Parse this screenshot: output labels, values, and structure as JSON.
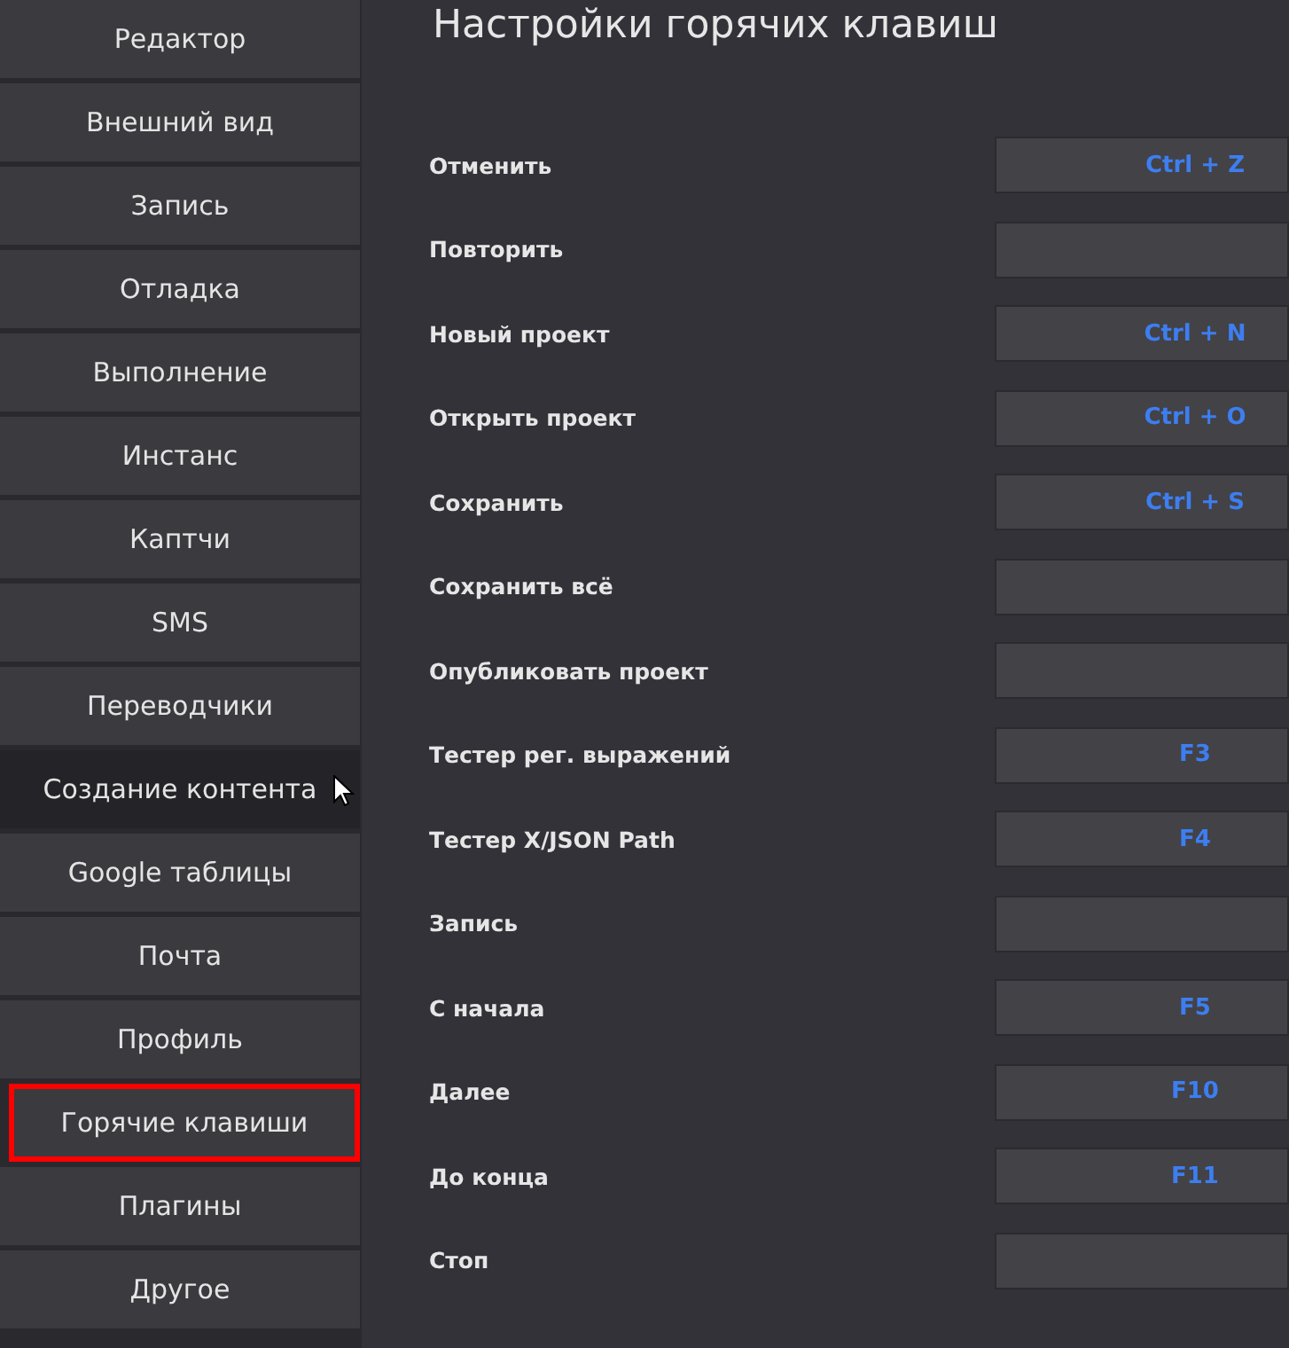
{
  "sidebar": {
    "items": [
      {
        "label": "Редактор",
        "selected": false,
        "hovered": false
      },
      {
        "label": "Внешний вид",
        "selected": false,
        "hovered": false
      },
      {
        "label": "Запись",
        "selected": false,
        "hovered": false
      },
      {
        "label": "Отладка",
        "selected": false,
        "hovered": false
      },
      {
        "label": "Выполнение",
        "selected": false,
        "hovered": false
      },
      {
        "label": "Инстанс",
        "selected": false,
        "hovered": false
      },
      {
        "label": "Каптчи",
        "selected": false,
        "hovered": false
      },
      {
        "label": "SMS",
        "selected": false,
        "hovered": false
      },
      {
        "label": "Переводчики",
        "selected": false,
        "hovered": false
      },
      {
        "label": "Создание контента",
        "selected": false,
        "hovered": true
      },
      {
        "label": "Google таблицы",
        "selected": false,
        "hovered": false
      },
      {
        "label": "Почта",
        "selected": false,
        "hovered": false
      },
      {
        "label": "Профиль",
        "selected": false,
        "hovered": false
      },
      {
        "label": "Горячие клавиши",
        "selected": true,
        "hovered": false
      },
      {
        "label": "Плагины",
        "selected": false,
        "hovered": false
      },
      {
        "label": "Другое",
        "selected": false,
        "hovered": false
      }
    ]
  },
  "page": {
    "title": "Настройки горячих клавиш",
    "hotkeys": [
      {
        "label": "Отменить",
        "value": "Ctrl + Z"
      },
      {
        "label": "Повторить"
      },
      {
        "label": "Новый проект",
        "value": "Ctrl + N"
      },
      {
        "label": "Открыть проект",
        "value": "Ctrl + O"
      },
      {
        "label": "Сохранить",
        "value": "Ctrl + S"
      },
      {
        "label": "Сохранить всё"
      },
      {
        "label": "Опубликовать проект"
      },
      {
        "label": "Тестер рег. выражений",
        "value": "F3"
      },
      {
        "label": "Тестер X/JSON Path",
        "value": "F4"
      },
      {
        "label": "Запись"
      },
      {
        "label": "С начала",
        "value": "F5"
      },
      {
        "label": "Далее",
        "value": "F10"
      },
      {
        "label": "До конца",
        "value": "F11"
      },
      {
        "label": "Стоп"
      }
    ]
  }
}
